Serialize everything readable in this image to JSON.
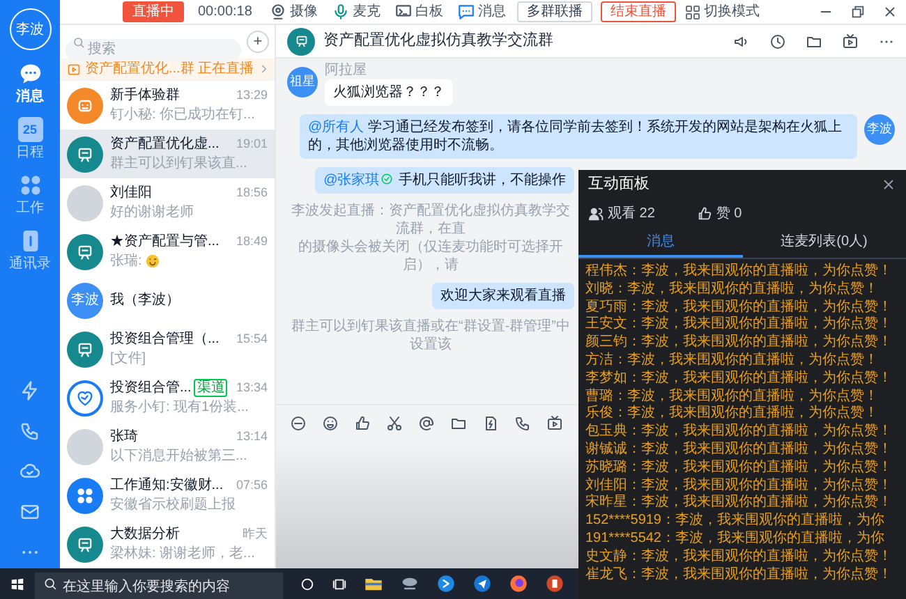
{
  "top_bar": {
    "live_badge": "直播中",
    "timer": "00:00:18",
    "tools": [
      {
        "kind": "camera",
        "label": "摄像"
      },
      {
        "kind": "mic",
        "label": "麦克"
      },
      {
        "kind": "whiteboard",
        "label": "白板"
      },
      {
        "kind": "message",
        "label": "消息"
      }
    ],
    "multi_button": "多群联播",
    "end_button": "结束直播",
    "switch_label": "切换模式"
  },
  "sidebar": {
    "avatar": "李波",
    "items": [
      {
        "kind": "chat",
        "label": "消息",
        "selected": true
      },
      {
        "kind": "calendar",
        "label": "日程",
        "badge": "25",
        "selected": false
      },
      {
        "kind": "apps",
        "label": "工作",
        "selected": false
      },
      {
        "kind": "contacts",
        "label": "通讯录",
        "selected": false
      }
    ]
  },
  "conversations": {
    "search": {
      "placeholder": "搜索"
    },
    "add_button": "+",
    "live_banner": "资产配置优化...群 正在直播",
    "items": [
      {
        "kind": "bot",
        "title": "新手体验群",
        "time": "13:29",
        "preview": "钉小秘: 你已成功在钉...",
        "selected": false
      },
      {
        "kind": "group",
        "title": "资产配置优化虚...",
        "time": "19:01",
        "preview": "群主可以到钉果该直...",
        "selected": true
      },
      {
        "kind": "photo",
        "title": "刘佳阳",
        "time": "18:56",
        "preview": "好的谢谢老师",
        "selected": false
      },
      {
        "kind": "group",
        "title": "★资产配置与管...",
        "time": "18:49",
        "preview": "张瑞:",
        "emoji": true,
        "selected": false
      },
      {
        "kind": "text",
        "avatar_text": "李波",
        "title": "我（李波）",
        "selected": false
      },
      {
        "kind": "group",
        "title": "投资组合管理（...",
        "time": "15:54",
        "preview": "[文件]",
        "selected": false
      },
      {
        "kind": "heart",
        "title": "投资组合管...",
        "badge": "渠道",
        "time": "13:34",
        "preview": "服务小钉: 现有1份装...",
        "selected": false
      },
      {
        "kind": "photo",
        "title": "张琦",
        "time": "13:14",
        "preview": "以下消息开始被第三...",
        "selected": false
      },
      {
        "kind": "apps",
        "title": "工作通知:安徽财...",
        "time": "07:56",
        "preview": "安徽省示校刷题上报",
        "selected": false
      },
      {
        "kind": "group",
        "title": "大数据分析",
        "time": "昨天",
        "preview": "梁林妹: 谢谢老师，老...",
        "selected": false
      }
    ]
  },
  "chat": {
    "title": "资产配置优化虚拟仿真教学交流群",
    "messages": [
      {
        "kind": "incoming",
        "sender": "阿拉屋",
        "avatar": "祖星",
        "text": "火狐浏览器？？？"
      },
      {
        "kind": "outgoing",
        "avatar": "李波",
        "mention": "@所有人",
        "text": "学习通已经发布签到，请各位同学前去签到！系统开发的网站是架构在火狐上的，其他浏览器使用时不流畅。"
      },
      {
        "kind": "outgoing",
        "mention": "@张家琪",
        "verified": true,
        "text": "手机只能听我讲，不能操作"
      },
      {
        "kind": "notice",
        "lines": [
          "李波发起直播：资产配置优化虚拟仿真教学交流群，在直",
          "的摄像头会被关闭（仅连麦功能时可选择开启），请"
        ]
      },
      {
        "kind": "outgoing",
        "text": "欢迎大家来观看直播"
      },
      {
        "kind": "notice",
        "lines": [
          "群主可以到钉果该直播或在“群设置-群管理”中设置该"
        ]
      }
    ]
  },
  "panel": {
    "title": "互动面板",
    "viewers": "观看 22",
    "likes": "赞 0",
    "tabs": [
      {
        "label": "消息",
        "selected": true
      },
      {
        "label": "连麦列表(0人)",
        "selected": false
      }
    ],
    "messages": [
      "程伟杰：李波，我来围观你的直播啦，为你点赞！",
      "刘晓：李波，我来围观你的直播啦，为你点赞！",
      "夏巧雨：李波，我来围观你的直播啦，为你点赞！",
      "王安文：李波，我来围观你的直播啦，为你点赞！",
      "颜三钧：李波，我来围观你的直播啦，为你点赞！",
      "方洁：李波，我来围观你的直播啦，为你点赞！",
      "李梦如：李波，我来围观你的直播啦，为你点赞！",
      "曹璐：李波，我来围观你的直播啦，为你点赞！",
      "乐俊：李波，我来围观你的直播啦，为你点赞！",
      "包玉典：李波，我来围观你的直播啦，为你点赞！",
      "谢铖诚：李波，我来围观你的直播啦，为你点赞！",
      "苏晓璐：李波，我来围观你的直播啦，为你点赞！",
      "刘佳阳：李波，我来围观你的直播啦，为你点赞！",
      "宋昨星：李波，我来围观你的直播啦，为你点赞！",
      "152****5919：李波，我来围观你的直播啦，为你",
      "191****5542：李波，我来围观你的直播啦，为你",
      "史文静：李波，我来围观你的直播啦，为你点赞！",
      "崔龙飞：李波，我来围观你的直播啦，为你点赞！"
    ]
  },
  "taskbar": {
    "search": {
      "placeholder": "在这里输入你要搜索的内容"
    }
  }
}
